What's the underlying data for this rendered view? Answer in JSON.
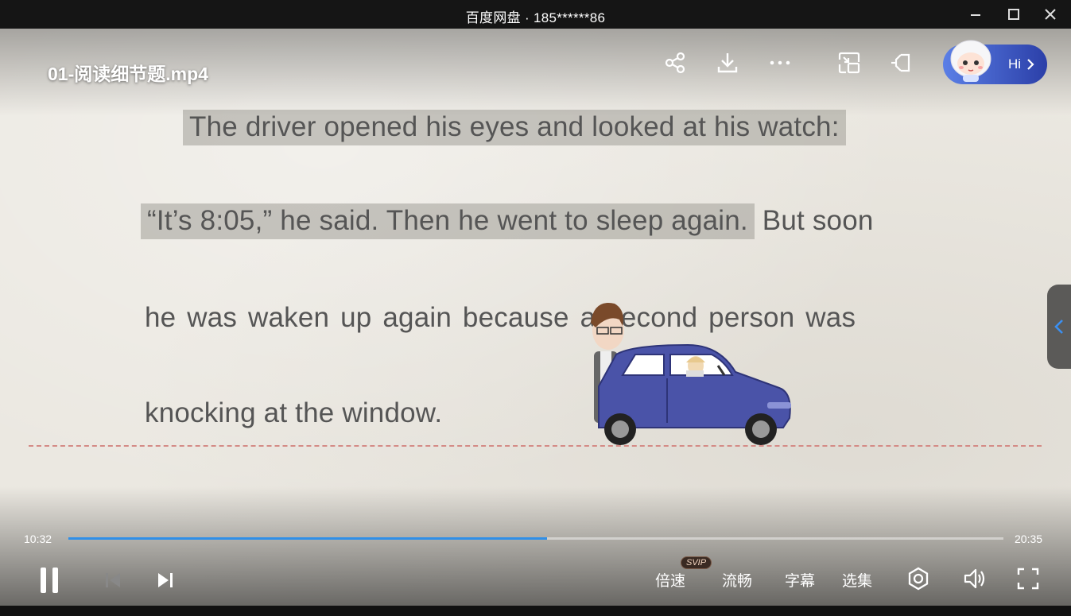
{
  "window": {
    "title": "百度网盘 · 185******86"
  },
  "player": {
    "filename": "01-阅读细节题.mp4",
    "assistant_label": "Hi",
    "current_time": "10:32",
    "total_time": "20:35",
    "progress_fraction": 0.512,
    "speed_label": "倍速",
    "svip_badge": "SVIP",
    "quality_label": "流畅",
    "subtitle_label": "字幕",
    "episodes_label": "选集"
  },
  "video_text": {
    "line1": "The driver opened his eyes and looked at his watch:",
    "line2_highlight": "“It’s 8:05,” he said. Then he went to sleep again.",
    "line2_rest": " But soon",
    "line3": "he  was  waken up  again  because a second  person  was",
    "line4": "knocking at the window."
  },
  "colors": {
    "accent": "#2f8fe8",
    "titlebar": "#151515",
    "hi_pill_start": "#5b7fe6",
    "hi_pill_end": "#2b3fa8"
  },
  "icons": [
    "share-icon",
    "download-icon",
    "more-icon",
    "pip-icon",
    "detach-icon",
    "minimize-icon",
    "maximize-icon",
    "close-icon",
    "pause-icon",
    "previous-icon",
    "next-icon",
    "loop-icon",
    "volume-icon",
    "fullscreen-icon",
    "chevron-left-icon"
  ]
}
